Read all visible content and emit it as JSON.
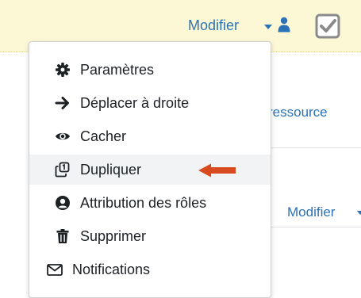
{
  "topbar": {
    "edit_label": "Modifier",
    "user_icon": "user-icon",
    "checkbox_icon": "checkbox-checked-icon",
    "bg_color": "#fcf8d6"
  },
  "background": {
    "resource_link": "ressource",
    "edit_label": "Modifier"
  },
  "menu": {
    "items": [
      {
        "label": "Paramètres",
        "icon": "gear-icon"
      },
      {
        "label": "Déplacer à droite",
        "icon": "arrow-right-icon"
      },
      {
        "label": "Cacher",
        "icon": "eye-icon"
      },
      {
        "label": "Dupliquer",
        "icon": "duplicate-icon"
      },
      {
        "label": "Attribution des rôles",
        "icon": "user-circle-icon"
      },
      {
        "label": "Supprimer",
        "icon": "trash-icon"
      },
      {
        "label": "Notifications",
        "icon": "envelope-icon"
      }
    ]
  },
  "annotation": {
    "arrow_color": "#d94a1e",
    "arrow_icon": "red-arrow-left-icon"
  },
  "colors": {
    "link": "#2a73b8",
    "text": "#1d2125",
    "highlight": "#f1f3f5"
  }
}
